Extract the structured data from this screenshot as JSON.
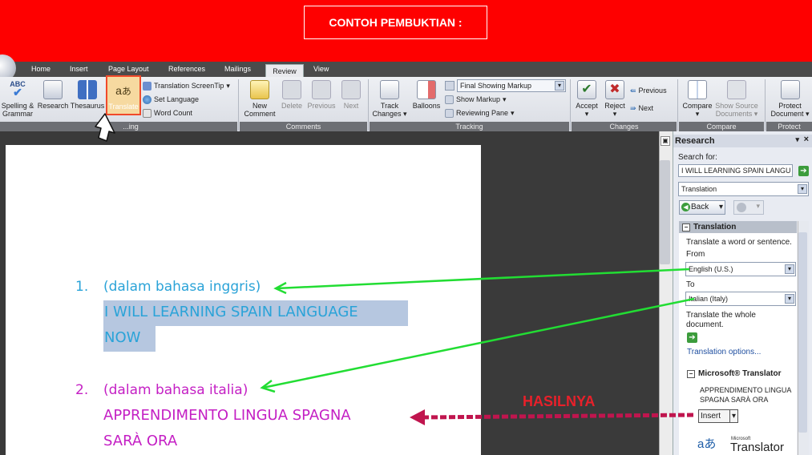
{
  "banner": {
    "title": "CONTOH PEMBUKTIAN :"
  },
  "tabs": [
    "Home",
    "Insert",
    "Page Layout",
    "References",
    "Mailings",
    "Review",
    "View"
  ],
  "ribbon": {
    "proofing": {
      "spelling": "Spelling &",
      "spelling2": "Grammar",
      "research": "Research",
      "thesaurus": "Thesaurus",
      "translate": "Translate",
      "translation_screentip": "Translation ScreenTip",
      "set_language": "Set Language",
      "word_count": "Word Count",
      "label": "...ing"
    },
    "comments": {
      "new1": "New",
      "new2": "Comment",
      "delete": "Delete",
      "previous": "Previous",
      "next": "Next",
      "label": "Comments"
    },
    "tracking": {
      "track1": "Track",
      "track2": "Changes",
      "balloons": "Balloons",
      "markup_select": "Final Showing Markup",
      "show_markup": "Show Markup",
      "reviewing_pane": "Reviewing Pane",
      "label": "Tracking"
    },
    "changes": {
      "accept": "Accept",
      "reject": "Reject",
      "previous": "Previous",
      "next": "Next",
      "label": "Changes"
    },
    "compare": {
      "compare": "Compare",
      "show_source1": "Show Source",
      "show_source2": "Documents",
      "label": "Compare"
    },
    "protect": {
      "protect1": "Protect",
      "protect2": "Document",
      "label": "Protect"
    }
  },
  "document": {
    "item1_num": "1.",
    "item1_label": "(dalam bahasa inggris)",
    "item1_line1": "I WILL LEARNING SPAIN LANGUAGE",
    "item1_line2": "NOW",
    "item2_num": "2.",
    "item2_label": "(dalam bahasa italia)",
    "item2_line1": "APPRENDIMENTO LINGUA SPAGNA",
    "item2_line2": "SARÀ ORA"
  },
  "annotation": {
    "result": "HASILNYA"
  },
  "research_pane": {
    "title": "Research",
    "search_for_label": "Search for:",
    "search_value": "I WILL LEARNING SPAIN LANGU",
    "service": "Translation",
    "back": "Back",
    "translation_header": "Translation",
    "instruction": "Translate a word or sentence.",
    "from_label": "From",
    "from_value": "English (U.S.)",
    "to_label": "To",
    "to_value": "Italian (Italy)",
    "whole_doc1": "Translate the whole",
    "whole_doc2": "document.",
    "options_link": "Translation options...",
    "ms_translator": "Microsoft® Translator",
    "result_line1": "APPRENDIMENTO LINGUA",
    "result_line2": "SPAGNA SARÀ ORA",
    "insert": "Insert",
    "logo_small": "Microsoft",
    "logo_text": "Translator"
  },
  "colors": {
    "banner": "#fe0000",
    "item1": "#2aa3d8",
    "item2": "#c41fc4",
    "arrow_green": "#22dd33",
    "arrow_red": "#c0154e",
    "selection": "#b6c7e0"
  }
}
